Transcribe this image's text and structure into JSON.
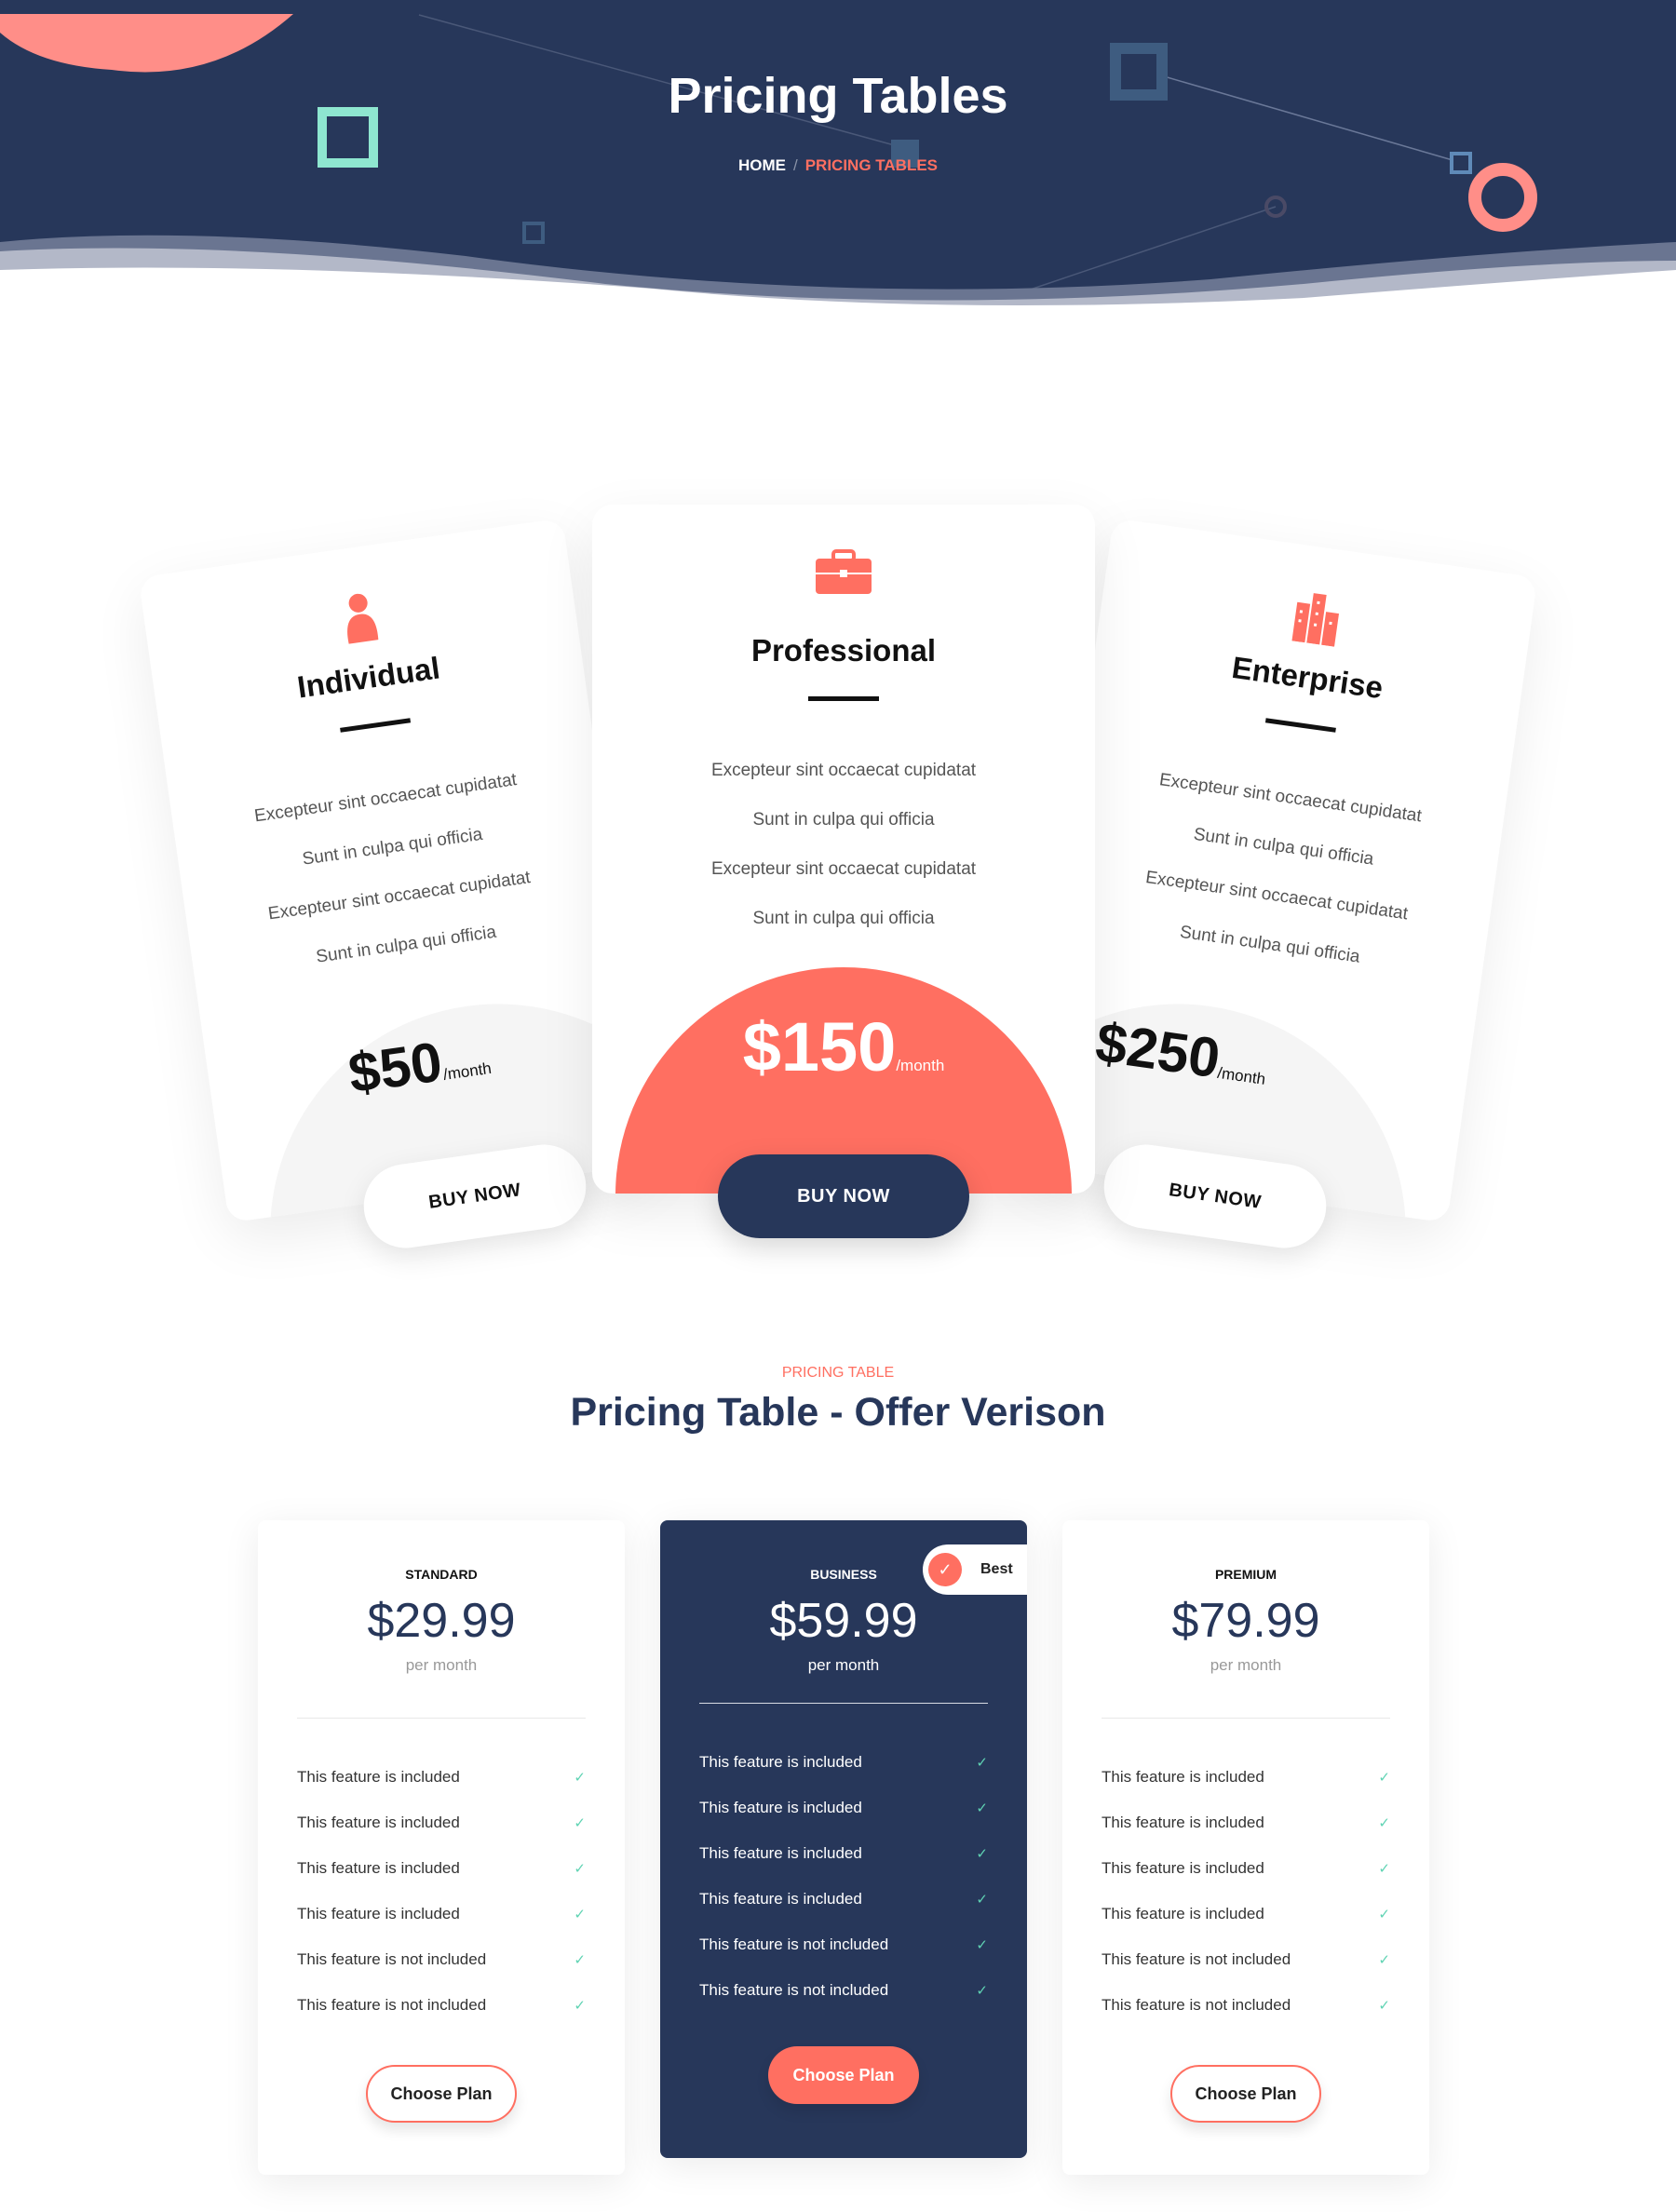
{
  "header": {
    "title": "Pricing Tables",
    "breadcrumb": {
      "home": "HOME",
      "separator": "/",
      "current": "PRICING TABLES"
    }
  },
  "colors": {
    "navy": "#27375a",
    "coral": "#ff6f61",
    "mint": "#8ee6d0",
    "check": "#5fd3b3"
  },
  "plans": [
    {
      "name": "Individual",
      "icon": "person-icon",
      "features": [
        "Excepteur sint occaecat cupidatat",
        "Sunt in culpa qui officia",
        "Excepteur sint occaecat cupidatat",
        "Sunt in culpa qui officia"
      ],
      "price": "$50",
      "period": "/month",
      "button": "BUY NOW"
    },
    {
      "name": "Professional",
      "icon": "briefcase-icon",
      "features": [
        "Excepteur sint occaecat cupidatat",
        "Sunt in culpa qui officia",
        "Excepteur sint occaecat cupidatat",
        "Sunt in culpa qui officia"
      ],
      "price": "$150",
      "period": "/month",
      "button": "BUY NOW"
    },
    {
      "name": "Enterprise",
      "icon": "building-icon",
      "features": [
        "Excepteur sint occaecat cupidatat",
        "Sunt in culpa qui officia",
        "Excepteur sint occaecat cupidatat",
        "Sunt in culpa qui officia"
      ],
      "price": "$250",
      "period": "/month",
      "button": "BUY NOW"
    }
  ],
  "offer": {
    "label": "PRICING TABLE",
    "title": "Pricing Table - Offer Verison",
    "badge": "Best",
    "cards": [
      {
        "name": "STANDARD",
        "price": "$29.99",
        "period": "per month",
        "features": [
          "This feature is included",
          "This feature is included",
          "This feature is included",
          "This feature is included",
          "This feature is not included",
          "This feature is not included"
        ],
        "button": "Choose Plan"
      },
      {
        "name": "BUSINESS",
        "price": "$59.99",
        "period": "per month",
        "features": [
          "This feature is included",
          "This feature is included",
          "This feature is included",
          "This feature is included",
          "This feature is not included",
          "This feature is not included"
        ],
        "button": "Choose Plan"
      },
      {
        "name": "PREMIUM",
        "price": "$79.99",
        "period": "per month",
        "features": [
          "This feature is included",
          "This feature is included",
          "This feature is included",
          "This feature is included",
          "This feature is not included",
          "This feature is not included"
        ],
        "button": "Choose Plan"
      }
    ]
  }
}
